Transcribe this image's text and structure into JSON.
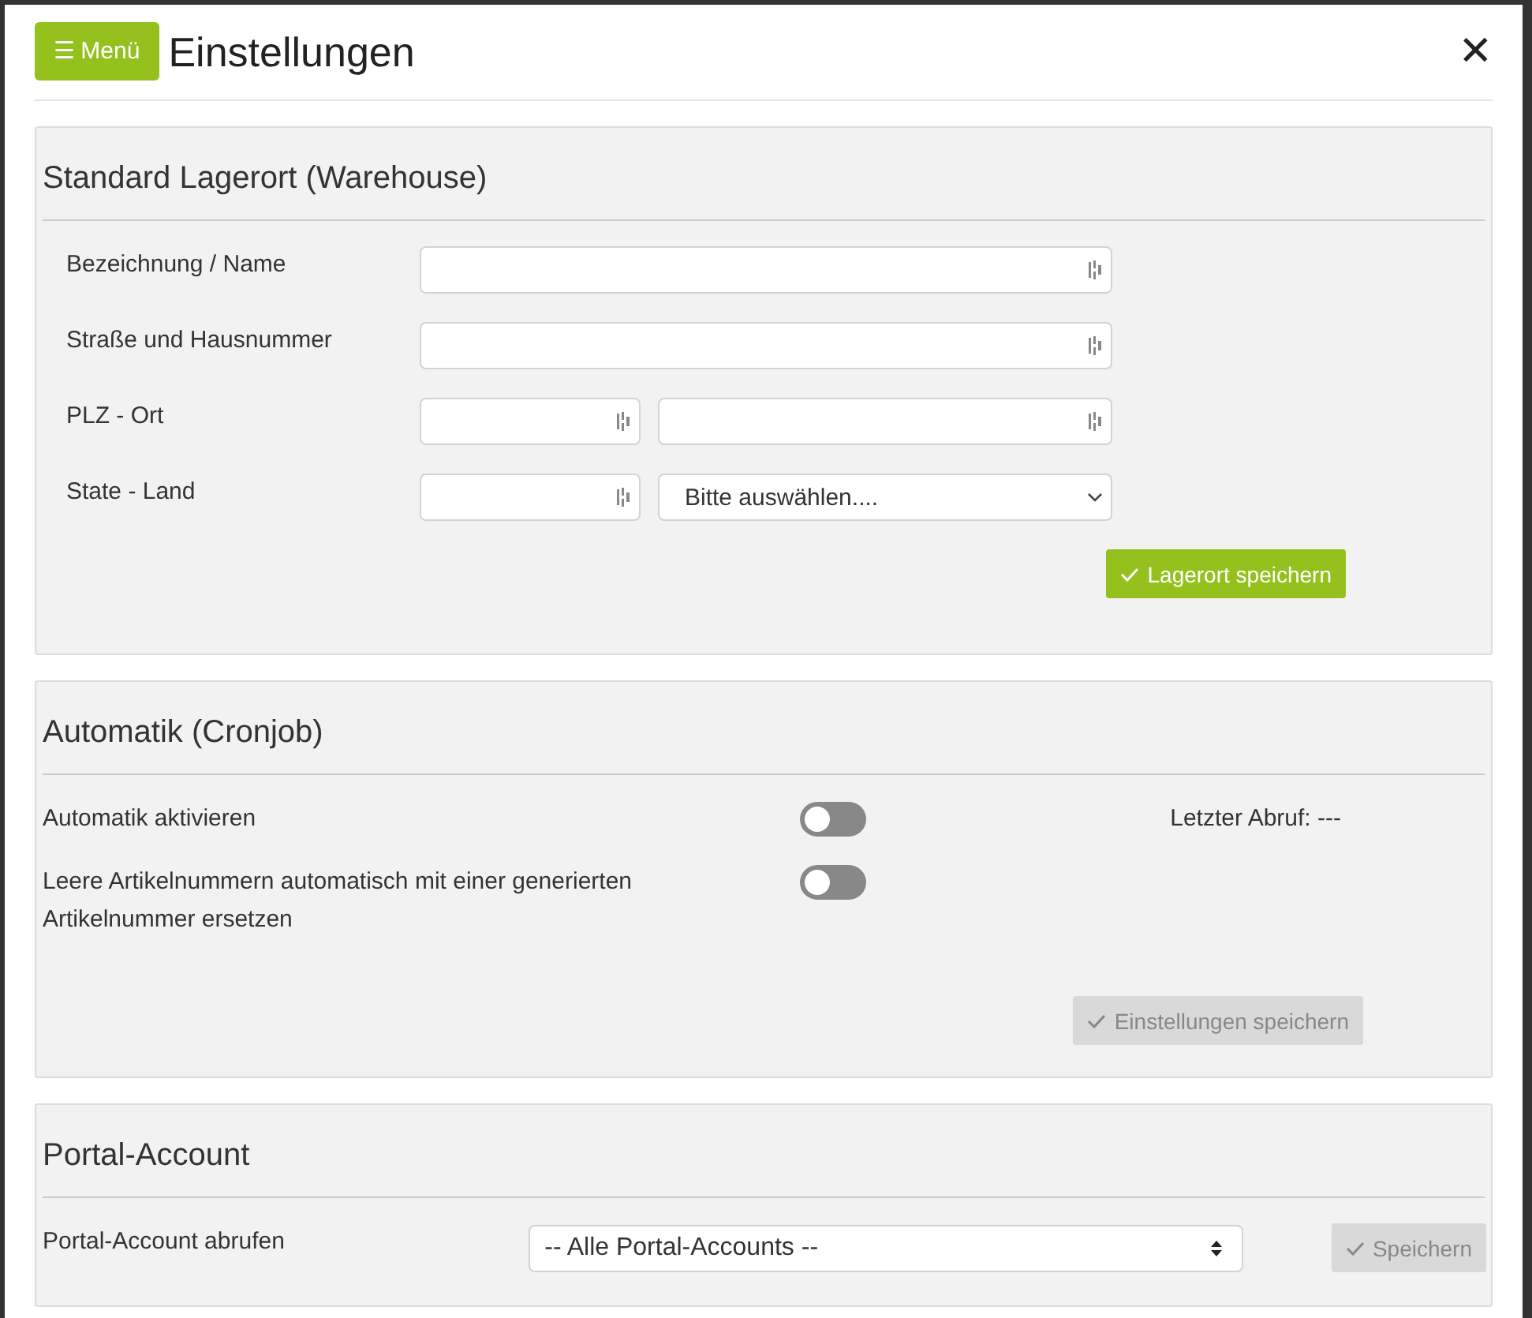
{
  "header": {
    "menu_button": "☰ Menü",
    "title": "Einstellungen",
    "close": "✕"
  },
  "warehouse": {
    "title": "Standard Lagerort (Warehouse)",
    "rows": [
      {
        "label": "Bezeichnung / Name",
        "fields": [
          {
            "kind": "text"
          }
        ]
      },
      {
        "label": "Straße und Hausnummer",
        "fields": [
          {
            "kind": "text"
          }
        ]
      },
      {
        "label": "PLZ - Ort",
        "fields": [
          {
            "kind": "text"
          },
          {
            "kind": "text"
          }
        ]
      },
      {
        "label": "State - Land",
        "fields": [
          {
            "kind": "text"
          },
          {
            "kind": "select",
            "value": "Bitte auswählen...."
          }
        ]
      }
    ],
    "button": {
      "label": "Lagerort speichern",
      "disabled": false
    }
  },
  "automatik": {
    "title": "Automatik (Cronjob)",
    "toggles": [
      {
        "label": "Automatik aktivieren",
        "on": false
      },
      {
        "label": "Leere Artikelnummern automatisch mit einer generierten Artikelnummer ersetzen",
        "on": false
      }
    ],
    "last_fetch": "Letzter Abruf: ---",
    "button": {
      "label": "Einstellungen speichern",
      "disabled": true
    }
  },
  "portal": {
    "title": "Portal-Account",
    "label": "Portal-Account abrufen",
    "select": "-- Alle Portal-Accounts --",
    "button": {
      "label": "Speichern",
      "disabled": true
    }
  }
}
